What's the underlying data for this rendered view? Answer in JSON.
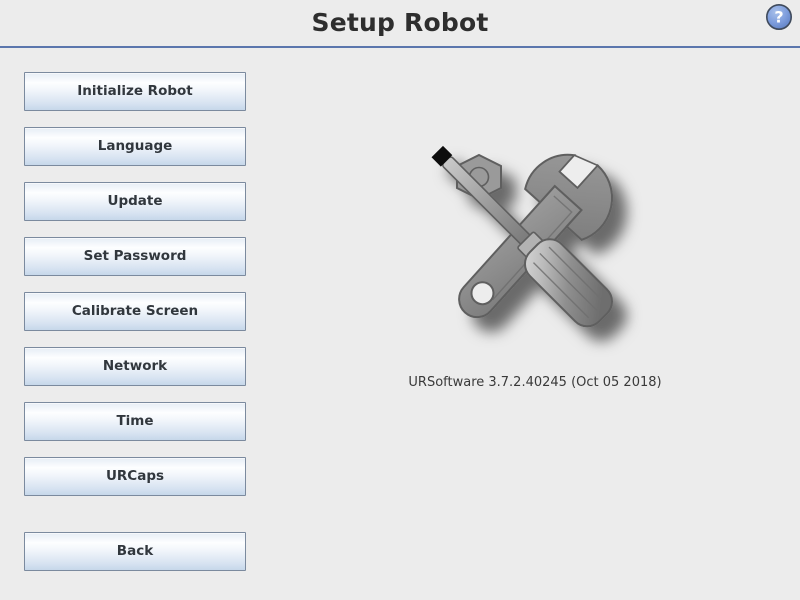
{
  "header": {
    "title": "Setup Robot",
    "help_icon": "help-question-circle-icon"
  },
  "sidebar": {
    "items": [
      {
        "label": "Initialize Robot",
        "name": "initialize-robot"
      },
      {
        "label": "Language",
        "name": "language"
      },
      {
        "label": "Update",
        "name": "update"
      },
      {
        "label": "Set Password",
        "name": "set-password"
      },
      {
        "label": "Calibrate Screen",
        "name": "calibrate-screen"
      },
      {
        "label": "Network",
        "name": "network"
      },
      {
        "label": "Time",
        "name": "time"
      },
      {
        "label": "URCaps",
        "name": "urcaps"
      }
    ],
    "back": {
      "label": "Back",
      "name": "back"
    }
  },
  "main": {
    "illustration": "wrench-and-screwdriver-icon",
    "version": "URSoftware 3.7.2.40245 (Oct 05 2018)"
  },
  "colors": {
    "background": "#ececec",
    "header_rule": "#5b76ad",
    "button_border": "#7b8a9e",
    "button_top": "#fdfeff",
    "button_bottom": "#c6d7ea",
    "text": "#31373d",
    "help_blue": "#6f91d6",
    "tool_gray": "#8f8f8f"
  }
}
